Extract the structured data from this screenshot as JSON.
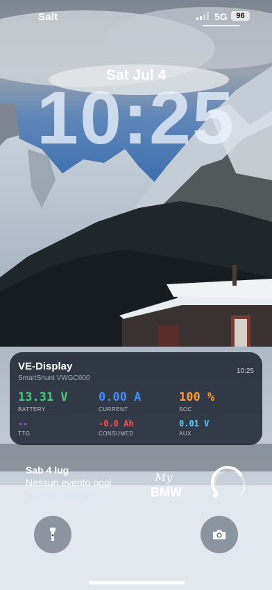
{
  "status": {
    "carrier": "Salt",
    "network": "5G",
    "battery": "96"
  },
  "lock": {
    "date": "Sat Jul 4",
    "time": "10:25"
  },
  "ve_widget": {
    "title": "VE-Display",
    "subtitle": "SmartShunt VWGC600",
    "time": "10:25",
    "metrics": [
      {
        "value": "13.31 V",
        "label": "BATTERY",
        "color": "#3ecf7a"
      },
      {
        "value": "0.00 A",
        "label": "CURRENT",
        "color": "#3d8dff"
      },
      {
        "value": "100 %",
        "label": "SOC",
        "color": "#ff9a2e"
      },
      {
        "value": "--",
        "label": "TTG",
        "color": "#b56cff"
      },
      {
        "value": "-0.0 Ah",
        "label": "CONSUMED",
        "color": "#ff4d4d"
      },
      {
        "value": "0.01 V",
        "label": "AUX",
        "color": "#53d0ff"
      }
    ]
  },
  "calendar": {
    "date": "Sab 4 lug",
    "line1": "Nessun evento oggi",
    "line2": "Non hai impegni"
  },
  "bmw_widget": {
    "script": "My",
    "brand": "BMW"
  },
  "ring_progress": 0.72,
  "buttons": {
    "left_icon": "flashlight-icon",
    "right_icon": "camera-icon"
  }
}
